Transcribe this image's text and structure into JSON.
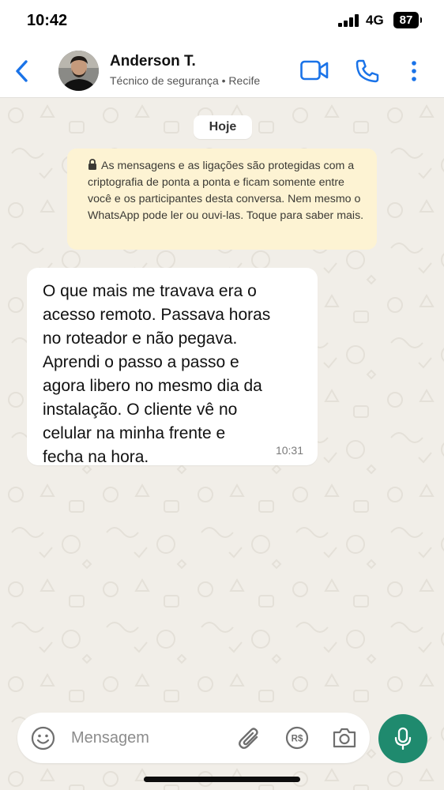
{
  "status_bar": {
    "time": "10:42",
    "network": "4G",
    "battery": "87"
  },
  "header": {
    "contact_name": "Anderson T.",
    "contact_subtitle": "Técnico de segurança • Recife",
    "icons": [
      "back-icon",
      "video-call-icon",
      "voice-call-icon",
      "more-options-icon"
    ],
    "accent_color": "#1a73e8"
  },
  "chat": {
    "date_label": "Hoje",
    "encryption_notice": "As mensagens e as ligações são protegidas com a criptografia de ponta a ponta e ficam somente entre você e os participantes desta conversa. Nem mesmo o WhatsApp pode ler ou ouvi-las. Toque para saber mais.",
    "messages": [
      {
        "text": "O que mais me travava era o\nacesso remoto. Passava horas\nno roteador e não pegava.\nAprendi o passo a passo e\nagora libero no mesmo dia da\ninstalação. O cliente vê no\ncelular na minha frente e\nfecha na hora.",
        "time": "10:31",
        "direction": "incoming"
      }
    ]
  },
  "composer": {
    "placeholder": "Mensagem",
    "icons": [
      "emoji-icon",
      "attach-icon",
      "payment-icon",
      "camera-icon",
      "mic-icon"
    ],
    "mic_color": "#1f8a6e"
  }
}
